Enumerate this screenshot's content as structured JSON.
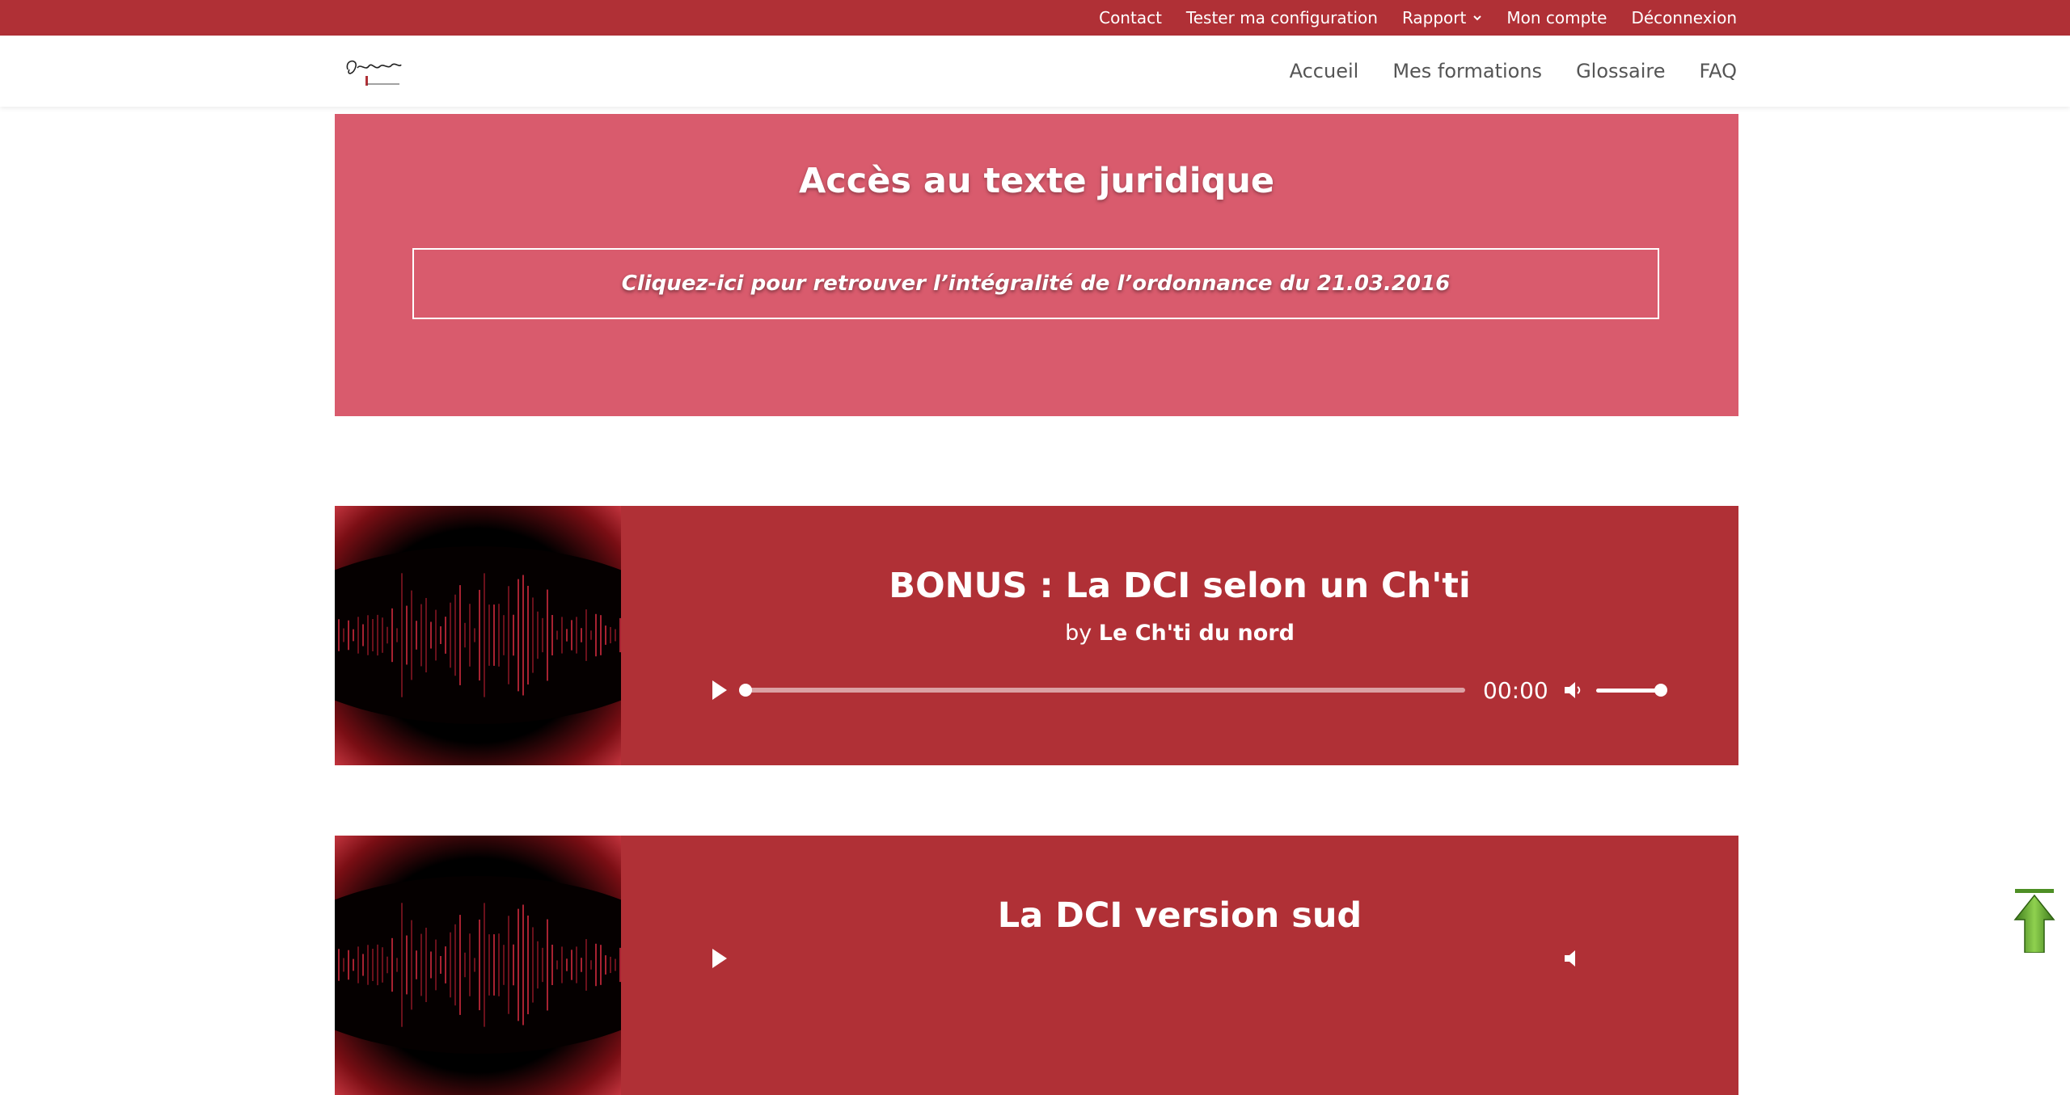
{
  "topbar": {
    "links": [
      "Contact",
      "Tester ma configuration",
      "Rapport",
      "Mon compte",
      "Déconnexion"
    ]
  },
  "header": {
    "nav": [
      "Accueil",
      "Mes formations",
      "Glossaire",
      "FAQ"
    ]
  },
  "legal": {
    "title": "Accès au texte juridique",
    "button": "Cliquez-ici pour retrouver l’intégralité de l’ordonnance du 21.03.2016"
  },
  "tracks": [
    {
      "title": "BONUS : La DCI selon un Ch'ti",
      "by_prefix": "by",
      "author": "Le Ch'ti du nord",
      "time": "00:00",
      "progress": 0,
      "volume": 1
    },
    {
      "title": "La DCI version sud"
    }
  ],
  "colors": {
    "topbar": "#b03036",
    "legal_bg": "#d95b6d",
    "card_bg": "#b03036"
  }
}
